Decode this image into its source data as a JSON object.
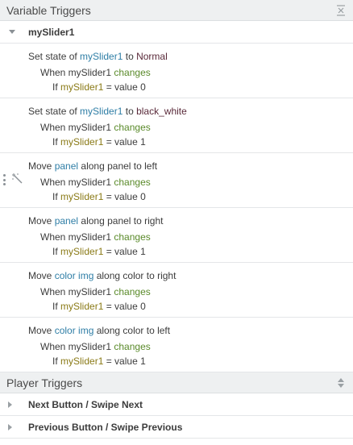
{
  "variable_triggers": {
    "title": "Variable Triggers",
    "group": {
      "label": "mySlider1"
    },
    "triggers": [
      {
        "action": "Set state of ",
        "object": "mySlider1",
        "mid": " to ",
        "target": "Normal",
        "when_prefix": "When mySlider1 ",
        "event": "changes",
        "if_prefix": "If ",
        "variable": "mySlider1",
        "condition": " = value 0"
      },
      {
        "action": "Set state of ",
        "object": "mySlider1",
        "mid": " to ",
        "target": "black_white",
        "when_prefix": "When mySlider1 ",
        "event": "changes",
        "if_prefix": "If ",
        "variable": "mySlider1",
        "condition": " = value 1"
      },
      {
        "action": "Move ",
        "object": "panel",
        "mid": " along panel to left",
        "target": "",
        "when_prefix": "When mySlider1 ",
        "event": "changes",
        "if_prefix": "If ",
        "variable": "mySlider1",
        "condition": " = value 0"
      },
      {
        "action": "Move ",
        "object": "panel",
        "mid": " along panel to right",
        "target": "",
        "when_prefix": "When mySlider1 ",
        "event": "changes",
        "if_prefix": "If ",
        "variable": "mySlider1",
        "condition": " = value 1"
      },
      {
        "action": "Move ",
        "object": "color img",
        "mid": " along color to right",
        "target": "",
        "when_prefix": "When mySlider1 ",
        "event": "changes",
        "if_prefix": "If ",
        "variable": "mySlider1",
        "condition": " = value 0"
      },
      {
        "action": "Move ",
        "object": "color img",
        "mid": " along color to left",
        "target": "",
        "when_prefix": "When mySlider1 ",
        "event": "changes",
        "if_prefix": "If ",
        "variable": "mySlider1",
        "condition": " = value 1"
      }
    ]
  },
  "player_triggers": {
    "title": "Player Triggers",
    "items": [
      {
        "label": "Next Button / Swipe Next"
      },
      {
        "label": "Previous Button / Swipe Previous"
      }
    ]
  },
  "icons": {
    "collapse": "collapse-all-icon",
    "sort": "sort-icon",
    "caret_down": "caret-down-icon",
    "caret_right": "caret-right-icon",
    "drag": "drag-handle-icon",
    "wand": "magic-wand-icon"
  },
  "colors": {
    "object": "#2f7ea6",
    "variable": "#8a7a16",
    "event": "#5a8a2a",
    "header_bg": "#eef0f1"
  }
}
